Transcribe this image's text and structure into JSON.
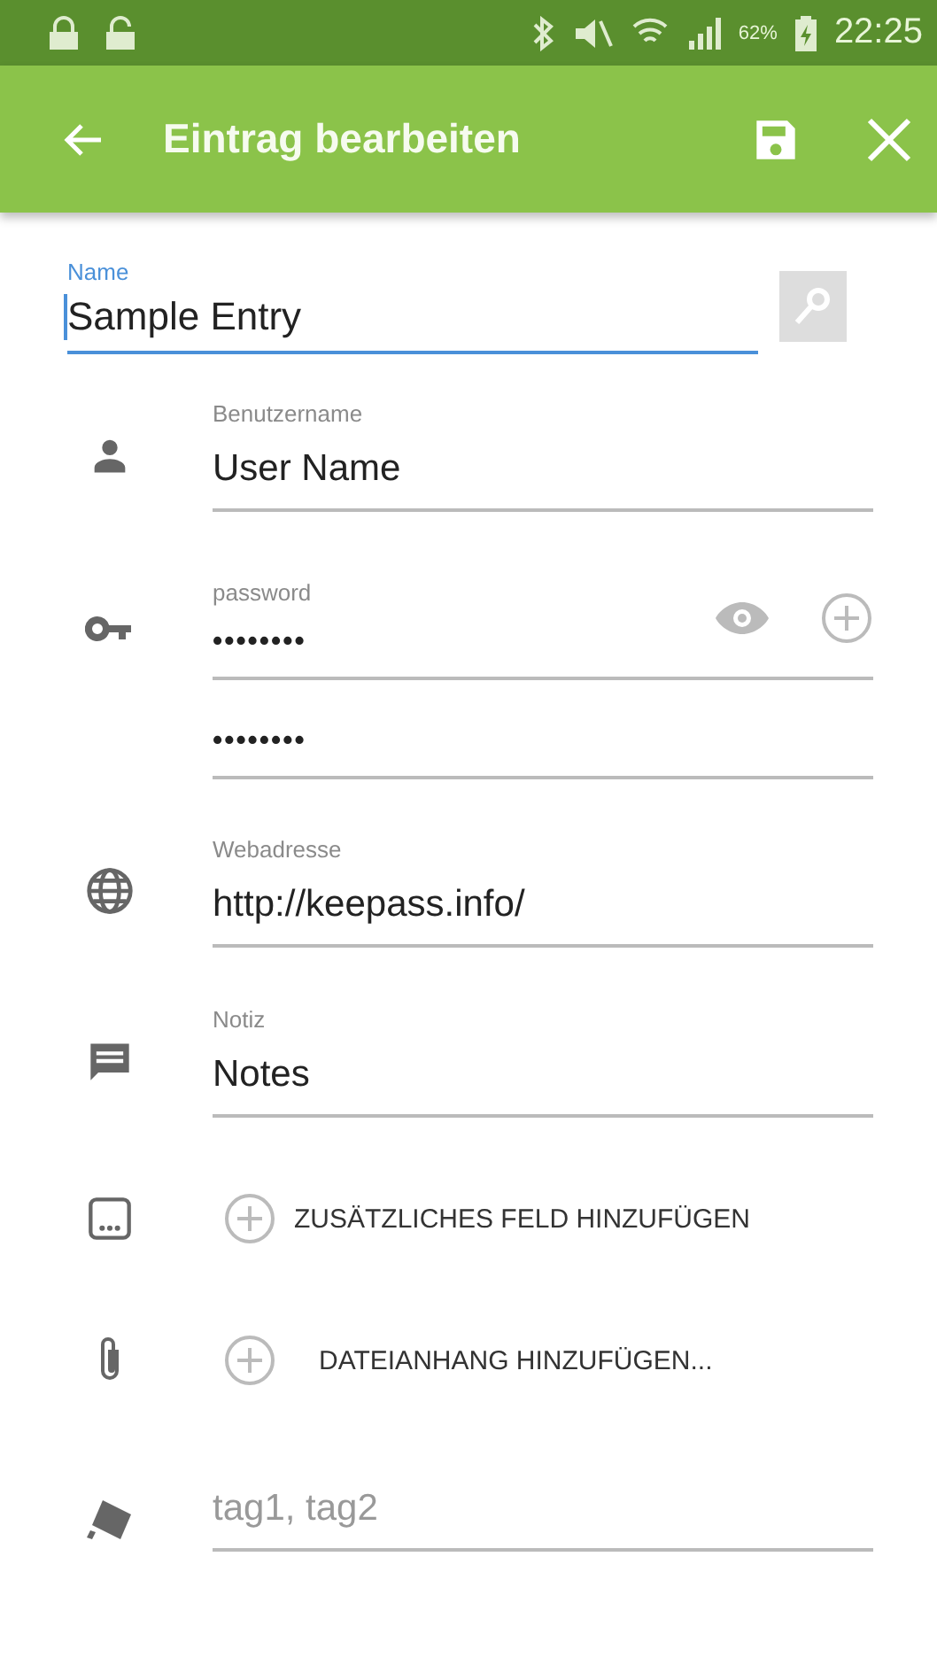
{
  "status_bar": {
    "battery": "62%",
    "time": "22:25"
  },
  "app_bar": {
    "title": "Eintrag bearbeiten"
  },
  "name_field": {
    "label": "Name",
    "value": "Sample Entry",
    "focused": true
  },
  "rows": [
    {
      "kind": "field",
      "label": "Benutzername",
      "value": "User Name"
    },
    {
      "kind": "password",
      "label": "password",
      "value": "••••••••"
    },
    {
      "kind": "confirm",
      "value": "••••••••"
    },
    {
      "kind": "field",
      "label": "Webadresse",
      "value": "http://keepass.info/"
    },
    {
      "kind": "field",
      "label": "Notiz",
      "value": "Notes"
    },
    {
      "kind": "action",
      "label": "ZUSÄTZLICHES FELD HINZUFÜGEN"
    },
    {
      "kind": "action",
      "label": "DATEIANHANG HINZUFÜGEN..."
    },
    {
      "kind": "tags",
      "placeholder": "tag1, tag2"
    }
  ]
}
